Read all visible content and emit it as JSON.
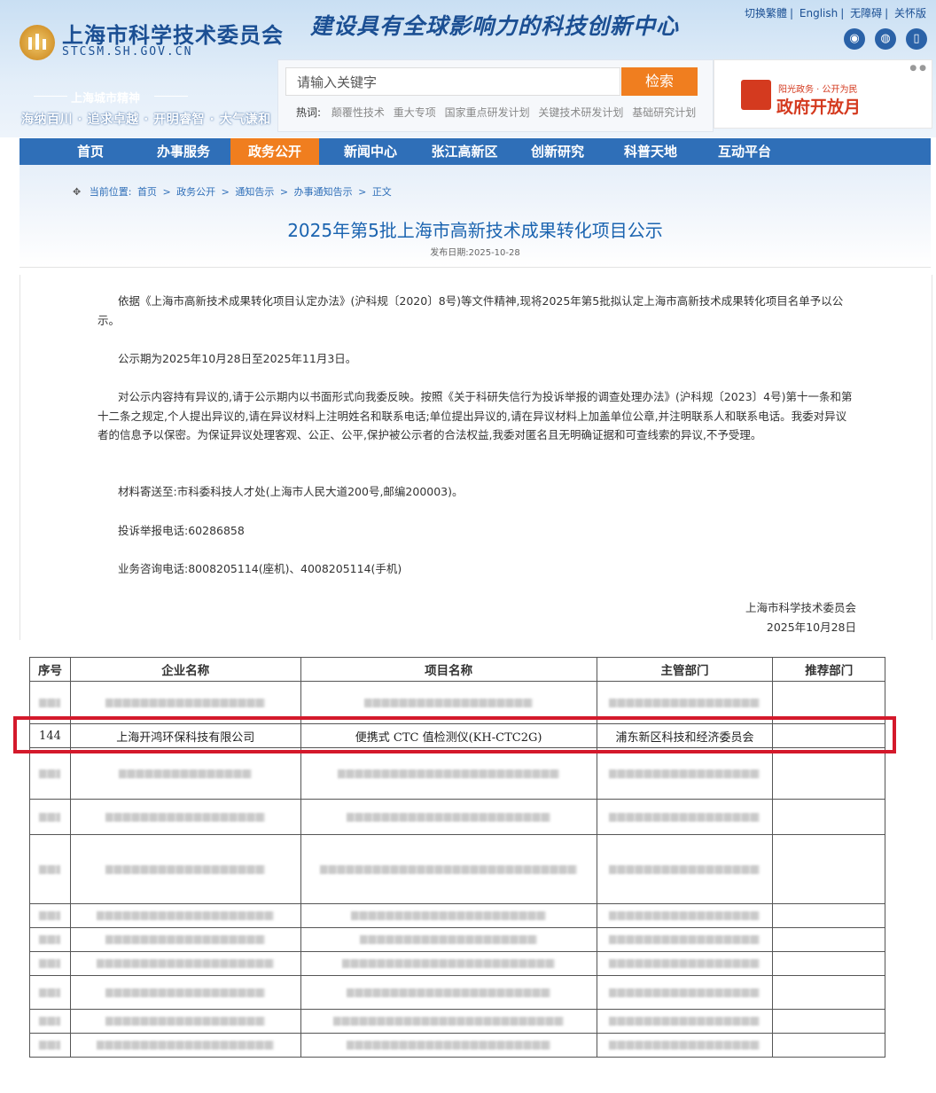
{
  "header": {
    "site_name": "上海市科学技术委员会",
    "site_domain": "STCSM.SH.GOV.CN",
    "slogan": "建设具有全球影响力的科技创新中心",
    "top_links": [
      "切换繁體",
      "English",
      "无障碍",
      "关怀版"
    ],
    "social_icons": [
      "weibo-icon",
      "wechat-icon",
      "mobile-icon"
    ],
    "spirit_title": "上海城市精神",
    "spirit_text": "海纳百川 · 追求卓越 · 开明睿智 · 大气谦和"
  },
  "search": {
    "placeholder": "请输入关键字",
    "button_label": "检索",
    "hot_label": "热词:",
    "hot_words": [
      "颠覆性技术",
      "重大专项",
      "国家重点研发计划",
      "关键技术研发计划",
      "基础研究计划"
    ]
  },
  "banner": {
    "small_text": "阳光政务 · 公开为民",
    "big_text": "政府开放月"
  },
  "nav": {
    "items": [
      "首页",
      "办事服务",
      "政务公开",
      "新闻中心",
      "张江高新区",
      "创新研究",
      "科普天地",
      "互动平台"
    ],
    "active": "政务公开"
  },
  "breadcrumb": {
    "label": "当前位置:",
    "items": [
      "首页",
      ">",
      "政务公开",
      ">",
      "通知告示",
      ">",
      "办事通知告示",
      ">",
      "正文"
    ]
  },
  "article": {
    "title": "2025年第5批上海市高新技术成果转化项目公示",
    "pub_date": "发布日期:2025-10-28",
    "paragraphs": [
      "依据《上海市高新技术成果转化项目认定办法》(沪科规〔2020〕8号)等文件精神,现将2025年第5批拟认定上海市高新技术成果转化项目名单予以公示。",
      "公示期为2025年10月28日至2025年11月3日。",
      "对公示内容持有异议的,请于公示期内以书面形式向我委反映。按照《关于科研失信行为投诉举报的调查处理办法》(沪科规〔2023〕4号)第十一条和第十二条之规定,个人提出异议的,请在异议材料上注明姓名和联系电话;单位提出异议的,请在异议材料上加盖单位公章,并注明联系人和联系电话。我委对异议者的信息予以保密。为保证异议处理客观、公正、公平,保护被公示者的合法权益,我委对匿名且无明确证据和可查线索的异议,不予受理。",
      "材料寄送至:市科委科技人才处(上海市人民大道200号,邮编200003)。",
      "投诉举报电话:60286858",
      "业务咨询电话:8008205114(座机)、4008205114(手机)"
    ],
    "signature_org": "上海市科学技术委员会",
    "signature_date": "2025年10月28日"
  },
  "table": {
    "headers": [
      "序号",
      "企业名称",
      "项目名称",
      "主管部门",
      "推荐部门"
    ],
    "highlighted_row": {
      "index": "144",
      "company": "上海开鸿环保科技有限公司",
      "project": "便携式 CTC 值检测仪(KH-CTC2G)",
      "department": "浦东新区科技和经济委员会",
      "recommender": ""
    }
  },
  "colors": {
    "brand_blue": "#1b4f93",
    "nav_blue": "#2f6fb8",
    "accent_orange": "#f07e1f",
    "highlight_red": "#d4192b"
  }
}
